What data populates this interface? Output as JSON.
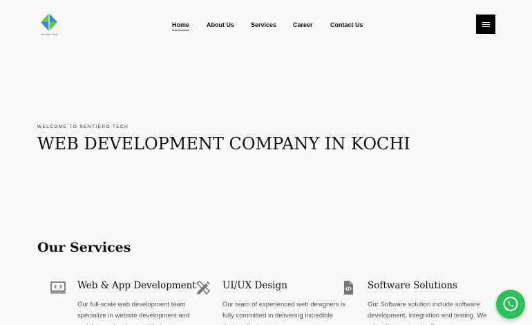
{
  "brand": {
    "name": "Sentiero Tech",
    "accent_green": "#6cc04a",
    "accent_blue": "#2a8fd6"
  },
  "nav": {
    "items": [
      {
        "label": "Home",
        "active": true
      },
      {
        "label": "About Us"
      },
      {
        "label": "Services"
      },
      {
        "label": "Career"
      },
      {
        "label": "Contact Us"
      }
    ],
    "menu_icon": "hamburger-icon"
  },
  "hero": {
    "eyebrow": "WELCOME TO SENTIERO TECH",
    "title": "WEB DEVELOPMENT COMPANY IN KOCHI"
  },
  "services": {
    "heading": "Our Services",
    "items": [
      {
        "icon": "code-monitor-icon",
        "title": "Web & App Development",
        "desc": "Our full-scale web development team specialize in website development and mobile app development that"
      },
      {
        "icon": "design-tools-icon",
        "title": "UI/UX Design",
        "desc": "Our team of experienced web designers is fully committed in delivering incredible designs that"
      },
      {
        "icon": "code-file-icon",
        "title": "Software Solutions",
        "desc": "Our Software solution include software development, integration and testing. We adopt the most apt software"
      }
    ]
  },
  "whatsapp": {
    "icon": "whatsapp-icon",
    "color": "#2bc15a"
  }
}
